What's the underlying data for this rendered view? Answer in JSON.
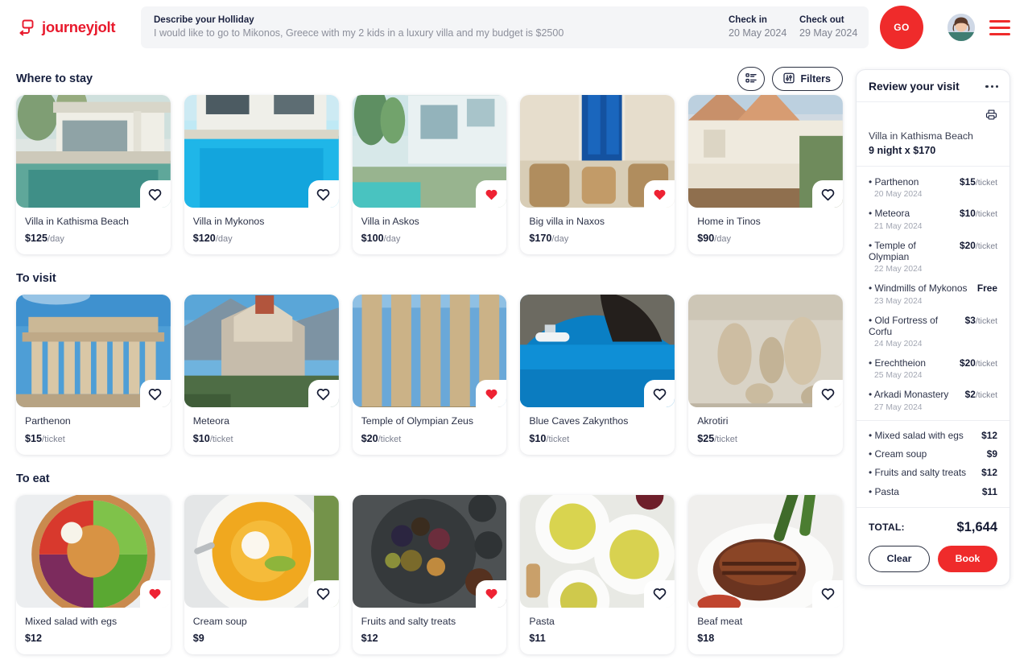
{
  "brand": {
    "name": "journeyjolt",
    "logo_icon": "journey-logo-icon"
  },
  "search": {
    "describe_label": "Describe your Holliday",
    "describe_value": "I would like to go to Mikonos, Greece with my 2 kids in a luxury villa and my budget is $2500",
    "checkin_label": "Check in",
    "checkin_value": "20 May 2024",
    "checkout_label": "Check out",
    "checkout_value": "29 May 2024",
    "go_label": "GO"
  },
  "toolbar": {
    "view_icon": "list-view-icon",
    "filters_label": "Filters",
    "filters_icon": "sliders-icon"
  },
  "sections": [
    {
      "id": "stay",
      "title": "Where to stay",
      "cards": [
        {
          "title": "Villa in Kathisma Beach",
          "price": "$125",
          "unit": "/day",
          "liked": false,
          "photo": "villa-pool-terrace"
        },
        {
          "title": "Villa in Mykonos",
          "price": "$120",
          "unit": "/day",
          "liked": false,
          "photo": "villa-blue-pool"
        },
        {
          "title": "Villa in Askos",
          "price": "$100",
          "unit": "/day",
          "liked": true,
          "photo": "villa-palm-modern"
        },
        {
          "title": "Big villa in Naxos",
          "price": "$170",
          "unit": "/day",
          "liked": true,
          "photo": "villa-blue-door-patio"
        },
        {
          "title": "Home in Tinos",
          "price": "$90",
          "unit": "/day",
          "liked": false,
          "photo": "home-stone-hillside"
        }
      ]
    },
    {
      "id": "visit",
      "title": "To visit",
      "cards": [
        {
          "title": "Parthenon",
          "price": "$15",
          "unit": "/ticket",
          "liked": false,
          "photo": "parthenon-columns"
        },
        {
          "title": "Meteora",
          "price": "$10",
          "unit": "/ticket",
          "liked": false,
          "photo": "meteora-cliff-monastery"
        },
        {
          "title": "Temple of Olympian Zeus",
          "price": "$20",
          "unit": "/ticket",
          "liked": true,
          "photo": "olympian-zeus-columns"
        },
        {
          "title": "Blue Caves Zakynthos",
          "price": "$10",
          "unit": "/ticket",
          "liked": false,
          "photo": "blue-caves-boat"
        },
        {
          "title": "Akrotiri",
          "price": "$25",
          "unit": "/ticket",
          "liked": false,
          "photo": "akrotiri-ruins-jars"
        }
      ]
    },
    {
      "id": "eat",
      "title": "To eat",
      "cards": [
        {
          "title": "Mixed salad with egs",
          "price": "$12",
          "unit": "",
          "liked": true,
          "photo": "mixed-salad-bowl"
        },
        {
          "title": "Cream soup",
          "price": "$9",
          "unit": "",
          "liked": false,
          "photo": "cream-soup-bowl"
        },
        {
          "title": "Fruits and salty treats",
          "price": "$12",
          "unit": "",
          "liked": true,
          "photo": "fruits-salty-platter"
        },
        {
          "title": "Pasta",
          "price": "$11",
          "unit": "",
          "liked": false,
          "photo": "pasta-plates-table"
        },
        {
          "title": "Beaf meat",
          "price": "$18",
          "unit": "",
          "liked": false,
          "photo": "steak-broccolini-plate"
        }
      ]
    }
  ],
  "review": {
    "title": "Review your visit",
    "menu_icon": "more-options-icon",
    "print_icon": "printer-icon",
    "stay_name": "Villa in Kathisma Beach",
    "stay_nights": "9 night x $170",
    "attractions": [
      {
        "name": "Parthenon",
        "price": "$15",
        "unit": "/ticket",
        "date": "20 May 2024"
      },
      {
        "name": "Meteora",
        "price": "$10",
        "unit": "/ticket",
        "date": "21 May 2024"
      },
      {
        "name": "Temple of Olympian",
        "price": "$20",
        "unit": "/ticket",
        "date": "22 May 2024"
      },
      {
        "name": "Windmills of Mykonos",
        "price": "Free",
        "unit": "",
        "date": "23 May 2024"
      },
      {
        "name": "Old Fortress of Corfu",
        "price": "$3",
        "unit": "/ticket",
        "date": "24 May 2024"
      },
      {
        "name": "Erechtheion",
        "price": "$20",
        "unit": "/ticket",
        "date": "25 May 2024"
      },
      {
        "name": "Arkadi Monastery",
        "price": "$2",
        "unit": "/ticket",
        "date": "27 May 2024"
      }
    ],
    "food": [
      {
        "name": "Mixed salad with egs",
        "price": "$12"
      },
      {
        "name": "Cream soup",
        "price": "$9"
      },
      {
        "name": "Fruits and salty treats",
        "price": "$12"
      },
      {
        "name": "Pasta",
        "price": "$11"
      }
    ],
    "total_label": "TOTAL:",
    "total_value": "$1,644",
    "clear_label": "Clear",
    "book_label": "Book"
  },
  "colors": {
    "accent": "#ef2b2b",
    "brand": "#e8192c",
    "ink": "#141a33",
    "muted": "#7c8090"
  }
}
